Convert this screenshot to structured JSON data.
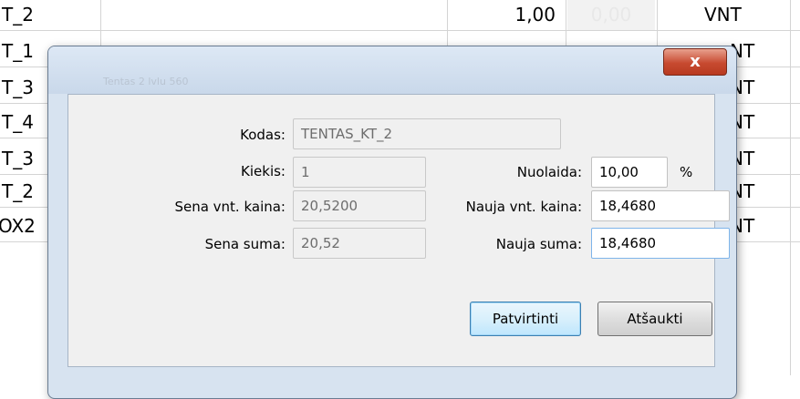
{
  "sheet": {
    "rows": [
      {
        "code": "T_2",
        "qty": "1,00",
        "discount": "0,00",
        "unit": "VNT"
      },
      {
        "code": "T_1",
        "qty": "",
        "discount": "",
        "unit": "NT"
      },
      {
        "code": "T_3",
        "qty": "",
        "discount": "",
        "unit": "NT"
      },
      {
        "code": "T_4",
        "qty": "",
        "discount": "",
        "unit": "NT"
      },
      {
        "code": "T_3",
        "qty": "",
        "discount": "",
        "unit": "NT"
      },
      {
        "code": "T_2",
        "qty": "",
        "discount": "",
        "unit": "NT"
      },
      {
        "code": "OX2",
        "qty": "",
        "discount": "",
        "unit": "NT"
      }
    ]
  },
  "dialog": {
    "close_glyph": "x",
    "background_text": "Tentas 2 lvlu 560",
    "code_label": "Kodas:",
    "code_value": "TENTAS_KT_2",
    "qty_label": "Kiekis:",
    "qty_value": "1",
    "discount_label": "Nuolaida:",
    "discount_value": "10,00",
    "discount_unit": "%",
    "old_price_label": "Sena vnt. kaina:",
    "old_price_value": "20,5200",
    "new_price_label": "Nauja vnt. kaina:",
    "new_price_value": "18,4680",
    "old_sum_label": "Sena suma:",
    "old_sum_value": "20,52",
    "new_sum_label": "Nauja suma:",
    "new_sum_value": "18,4680",
    "confirm_label": "Patvirtinti",
    "cancel_label": "Atšaukti"
  },
  "colors": {
    "dialog_frame": "#d7e3f0",
    "close_button": "#c74a30",
    "focus_border": "#7eb4ea"
  }
}
